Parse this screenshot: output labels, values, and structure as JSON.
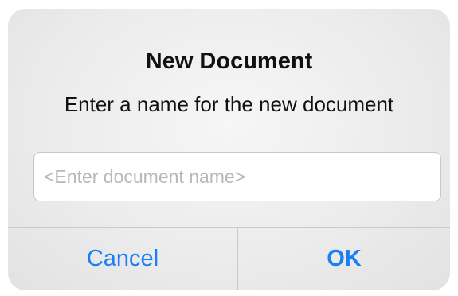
{
  "dialog": {
    "title": "New Document",
    "message": "Enter a name for the new document",
    "input": {
      "placeholder": "<Enter document name>",
      "value": ""
    },
    "buttons": {
      "cancel_label": "Cancel",
      "ok_label": "OK"
    }
  },
  "colors": {
    "button_accent": "#1a7ef5",
    "placeholder": "#b8b8b8",
    "divider": "#c9c9c9"
  }
}
